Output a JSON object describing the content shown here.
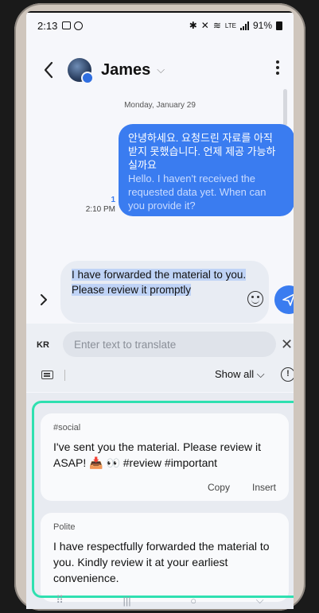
{
  "status_bar": {
    "time": "2:13",
    "network": "LTE",
    "battery": "91%"
  },
  "header": {
    "contact_name": "James",
    "back_icon": "chevron-left-icon",
    "more_icon": "kebab-icon"
  },
  "conversation": {
    "date_label": "Monday, January 29",
    "messages": [
      {
        "direction": "outgoing",
        "text_ko": "안녕하세요. 요청드린 자료를 아직 받지 못했습니다. 언제 제공 가능하실까요",
        "text_en": "Hello. I haven't received the requested data yet. When can you provide it?",
        "unread_count": "1",
        "time": "2:10 PM"
      }
    ]
  },
  "composer": {
    "text": "I have forwarded the material to you. Please review it promptly",
    "accent_color": "#3a7cf0"
  },
  "translator": {
    "language_chip": "KR",
    "placeholder": "Enter text to translate",
    "show_all_label": "Show all",
    "info_label": "!"
  },
  "suggestions": [
    {
      "tag": "#social",
      "text": "I've sent you the material. Please review it ASAP! 📥 👀 #review #important",
      "copy_label": "Copy",
      "insert_label": "Insert"
    },
    {
      "tag": "Polite",
      "text": "I have respectfully forwarded the material to you. Kindly review it at your earliest convenience."
    }
  ],
  "highlight_color": "#2fe0b0"
}
